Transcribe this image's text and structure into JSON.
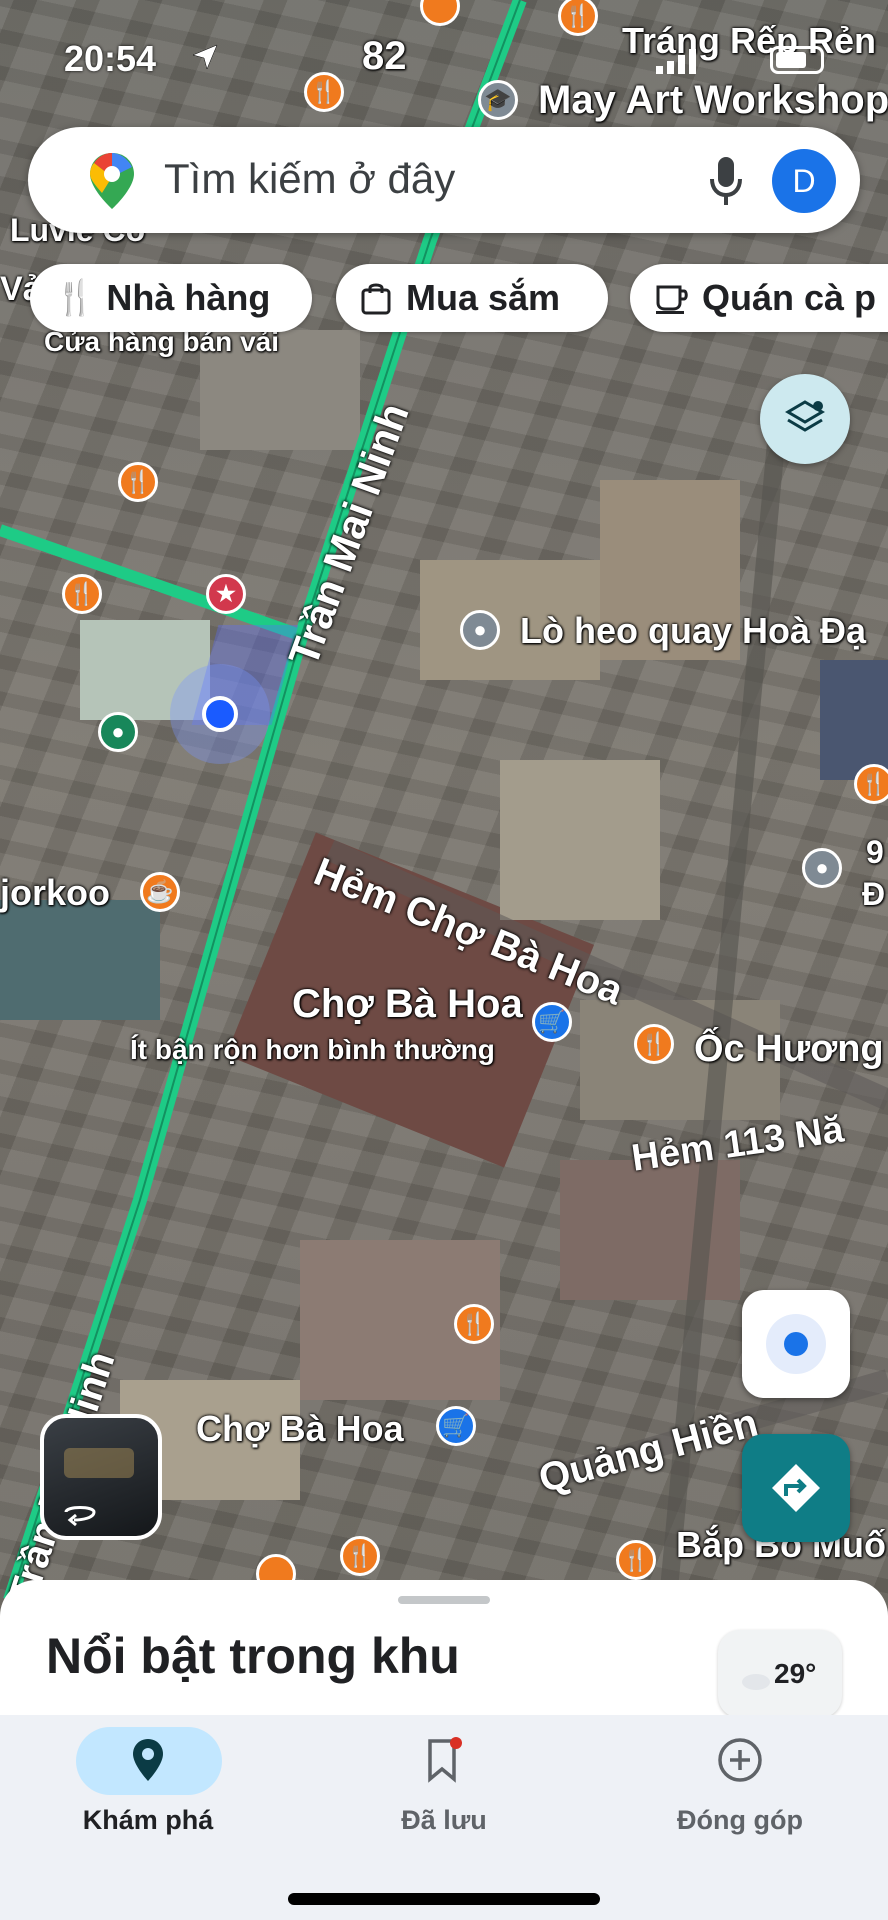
{
  "status_bar": {
    "time": "20:54"
  },
  "search": {
    "placeholder": "Tìm kiếm ở đây",
    "avatar_letter": "D"
  },
  "chips": [
    {
      "label": "Nhà hàng",
      "icon": "fork-knife-icon"
    },
    {
      "label": "Mua sắm",
      "icon": "shopping-bag-icon"
    },
    {
      "label": "Quán cà p",
      "icon": "coffee-cup-icon"
    }
  ],
  "map": {
    "route_badge": "82",
    "places": {
      "top_right_1": "Tráng Rếp Rẻn",
      "workshop": "May Art Workshop",
      "fabric_shop": "Cửa hàng bán vải",
      "lo_heo": "Lò heo quay Hoà Đạ",
      "jorkoo": "jorkoo",
      "cho_ba_hoa_main": "Chợ Bà Hoa",
      "busy_status": "Ít bận rộn hơn bình thường",
      "oc_huong": "Ốc Hương",
      "cho_ba_hoa_lower": "Chợ Bà Hoa",
      "bap_bo": "Bắp Bò Muố",
      "edge_9": "9",
      "edge_d": "Đ",
      "luvie": "Luvie Co",
      "va": "Vả"
    },
    "streets": {
      "tran_mai_ninh_upper": "Trần Mai Ninh",
      "tran_mai_ninh_lower": "Trần Mai Ninh",
      "hem_cho_ba_hoa": "Hẻm Chợ Bà Hoa",
      "hem_113": "Hẻm 113 Nă",
      "quang_hien": "Quảng Hiền"
    }
  },
  "sheet": {
    "title": "Nổi bật trong khu vực",
    "weather_temp": "29°"
  },
  "nav": {
    "items": [
      {
        "label": "Khám phá",
        "icon": "explore-pin-icon",
        "active": true
      },
      {
        "label": "Đã lưu",
        "icon": "bookmark-icon",
        "active": false
      },
      {
        "label": "Đóng góp",
        "icon": "add-circle-icon",
        "active": false
      }
    ]
  },
  "colors": {
    "route": "#1ecb86",
    "accent": "#1a73e8",
    "food_pin": "#f07a1e",
    "active_nav": "#c2e7ff",
    "teal_fab": "#0f7d86"
  }
}
